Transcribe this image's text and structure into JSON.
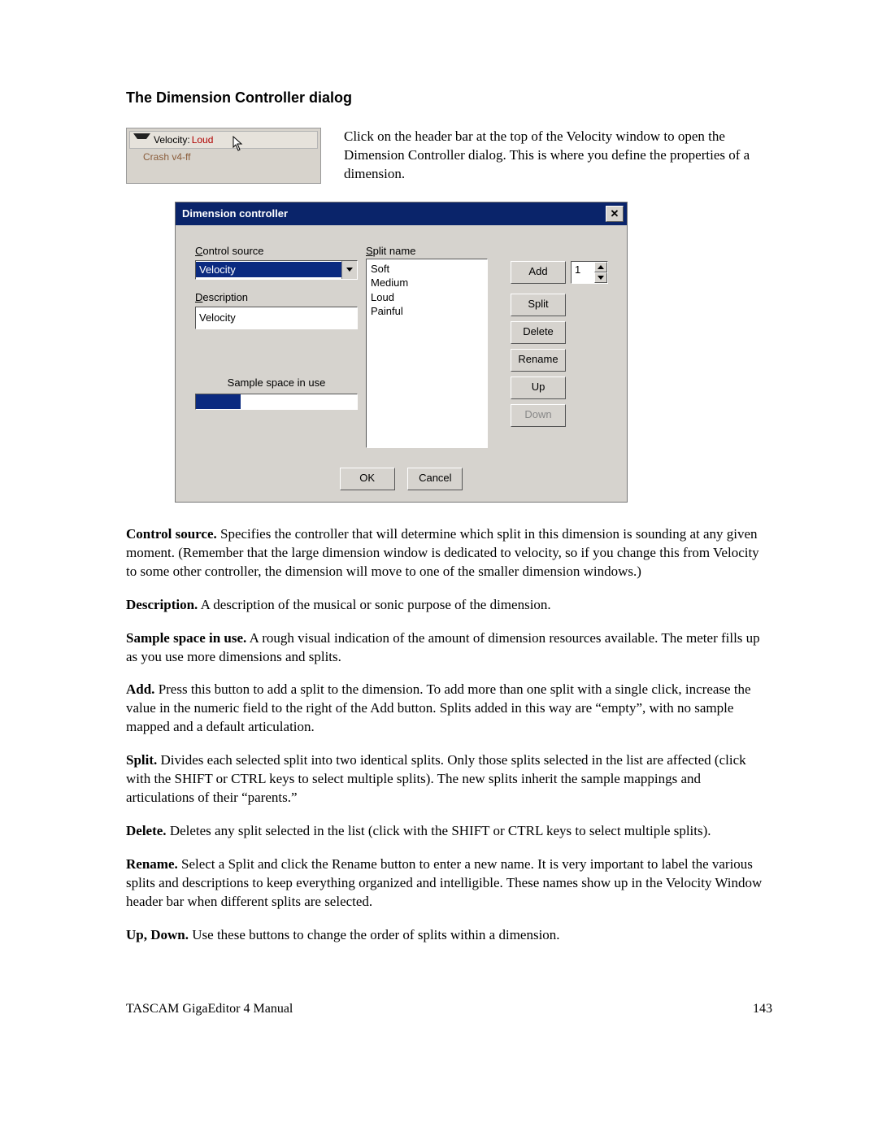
{
  "section_title": "The Dimension Controller dialog",
  "header_widget": {
    "label": "Velocity:",
    "value": "Loud",
    "row2": "Crash v4-ff"
  },
  "intro": "Click on the header bar at the top of the Velocity window to open the Dimension Controller dialog.  This is where you define the properties of a dimension.",
  "dialog": {
    "title": "Dimension controller",
    "control_source_label_pre": "C",
    "control_source_label_rest": "ontrol source",
    "control_source_value": "Velocity",
    "description_label_pre": "D",
    "description_label_rest": "escription",
    "description_value": "Velocity",
    "sample_space_label": "Sample space in use",
    "meter_pct": 28,
    "splitname_label_pre": "S",
    "splitname_label_rest": "plit name",
    "split_items": [
      "Soft",
      "Medium",
      "Loud",
      "Painful"
    ],
    "buttons": {
      "add": "Add",
      "split": "Split",
      "delete": "Delete",
      "rename": "Rename",
      "up": "Up",
      "down": "Down",
      "ok": "OK",
      "cancel": "Cancel"
    },
    "add_count": "1"
  },
  "paras": {
    "control_source_b": "Control source.",
    "control_source_t": "  Specifies the controller that will determine which split in this dimension is sounding at any given moment.  (Remember that the large dimension window is dedicated to velocity, so if you change this from Velocity to some other controller, the dimension will move to one of the smaller dimension windows.)",
    "description_b": "Description.",
    "description_t": "  A description of the musical or sonic purpose of the dimension.",
    "sample_b": "Sample space in use.",
    "sample_t": "  A rough visual indication of the amount of dimension resources available.  The meter fills up as you use more dimensions and splits.",
    "add_b": "Add.",
    "add_t": "  Press this button to add a split to the dimension.  To add more than one split with a single click, increase the value in the numeric field to the right of the Add button.  Splits added in this way are “empty”, with no sample mapped and a default articulation.",
    "split_b": "Split.",
    "split_t": "  Divides each selected split into two identical splits.  Only those splits selected in the list are affected (click with the SHIFT or CTRL keys to select multiple splits).  The new splits inherit the sample mappings and articulations of their “parents.”",
    "delete_b": "Delete.",
    "delete_t": "  Deletes any split selected in the list (click with the SHIFT or CTRL keys to select multiple splits).",
    "rename_b": "Rename.",
    "rename_t": "  Select a Split and click the Rename button to enter a new name.  It is very important to label the various splits and descriptions to keep everything organized and intelligible.  These names show up in the Velocity Window header bar when different splits are selected.",
    "updown_b": "Up, Down.",
    "updown_t": "  Use these buttons to change the order of splits within a dimension."
  },
  "footer": {
    "left": "TASCAM GigaEditor 4 Manual",
    "right": "143"
  }
}
